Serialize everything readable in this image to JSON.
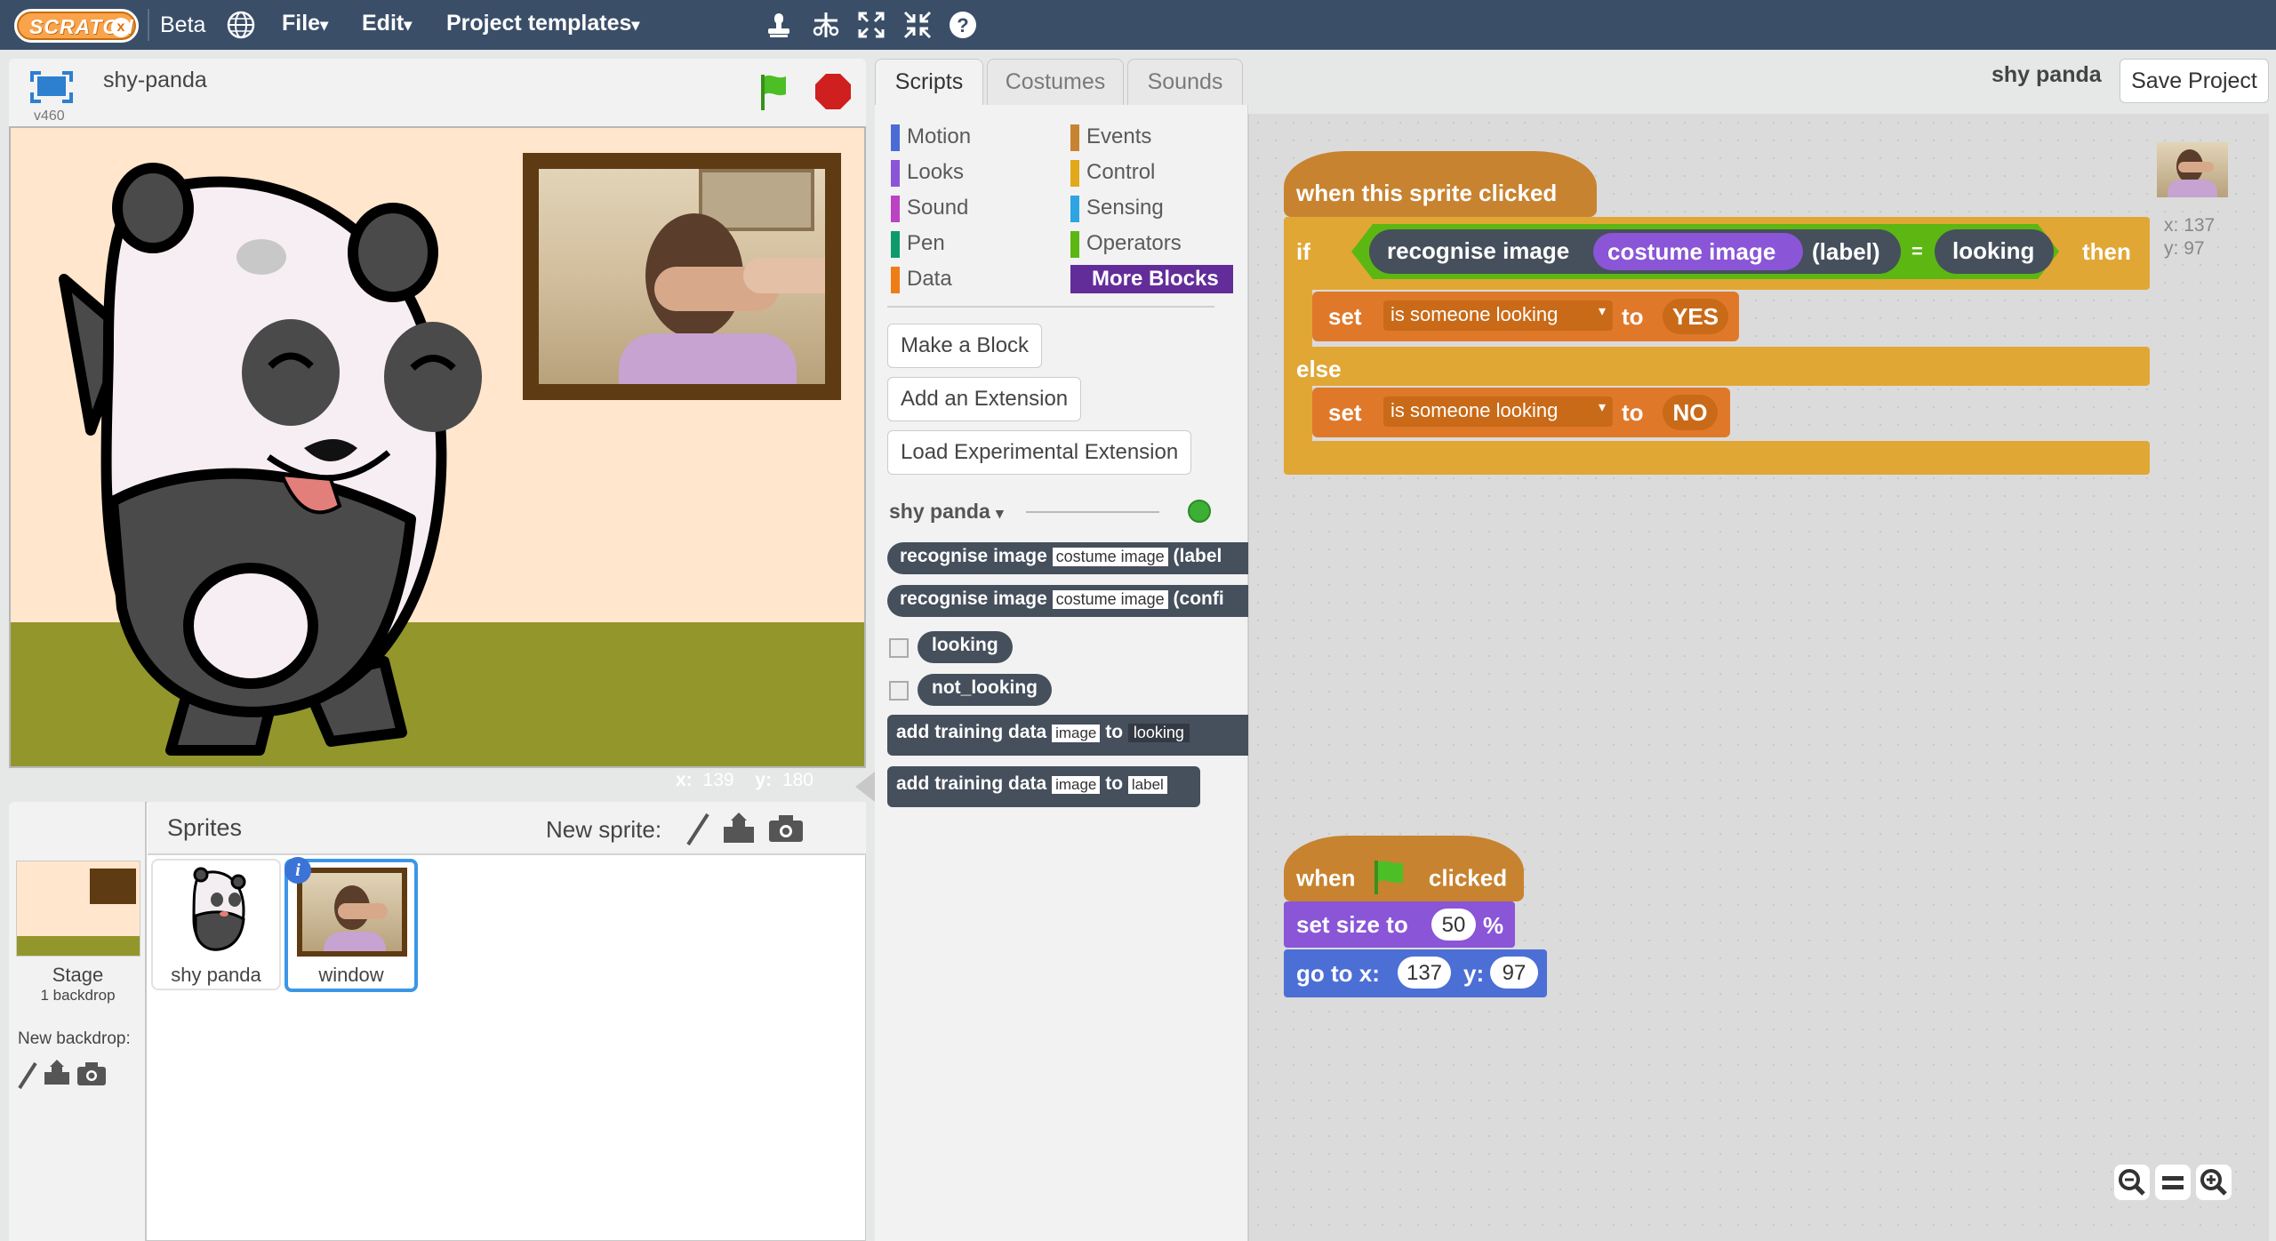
{
  "menubar": {
    "logo_text": "SCRATCH",
    "logo_x": "x",
    "beta": "Beta",
    "file": "File",
    "edit": "Edit",
    "templates": "Project templates",
    "caret": "▾",
    "icons": [
      "duplicate-stamp-icon",
      "cut-scissors-icon",
      "grow-icon",
      "shrink-icon",
      "help-icon"
    ]
  },
  "stage": {
    "project_name": "shy-panda",
    "version": "v460",
    "coords_x_label": "x:",
    "coords_x": "139",
    "coords_y_label": "y:",
    "coords_y": "180"
  },
  "sprites": {
    "header": "Sprites",
    "new_sprite": "New sprite:",
    "stage_label": "Stage",
    "stage_sub": "1 backdrop",
    "new_backdrop": "New backdrop:",
    "items": [
      {
        "name": "shy panda"
      },
      {
        "name": "window"
      }
    ]
  },
  "tabs": [
    {
      "label": "Scripts",
      "active": true
    },
    {
      "label": "Costumes",
      "active": false
    },
    {
      "label": "Sounds",
      "active": false
    }
  ],
  "top_right": {
    "sprite_name": "shy panda",
    "save": "Save Project"
  },
  "palette": {
    "categories_left": [
      "Motion",
      "Looks",
      "Sound",
      "Pen",
      "Data"
    ],
    "categories_right": [
      "Events",
      "Control",
      "Sensing",
      "Operators",
      "More Blocks"
    ],
    "colors_left": [
      "#4a6cd4",
      "#8a55d7",
      "#bb42c3",
      "#0e9a6c",
      "#ee7d16"
    ],
    "colors_right": [
      "#c88330",
      "#e1a91a",
      "#2ca5e2",
      "#5cb712",
      "#632d99"
    ],
    "make_block": "Make a Block",
    "add_extension": "Add an Extension",
    "load_experimental": "Load Experimental Extension",
    "extension_name": "shy panda",
    "status_color": "#3cb034",
    "blocks": {
      "recognise": "recognise",
      "image": "image",
      "costume_image": "costume image",
      "label_arg": "(label",
      "conf_arg": "(confi",
      "looking": "looking",
      "not_looking": "not_looking",
      "add": "add",
      "training": "training",
      "data": "data",
      "image_field": "image",
      "to": "to",
      "looking_field": "looking",
      "label_field": "label"
    }
  },
  "script1": {
    "hat": "when this sprite clicked",
    "if": "if",
    "recognise": "recognise",
    "image": "image",
    "costume_image": "costume image",
    "label": "(label)",
    "eq": "=",
    "looking": "looking",
    "then": "then",
    "set": "set",
    "var": "is someone looking",
    "to": "to",
    "yes": "YES",
    "else": "else",
    "no": "NO"
  },
  "script2": {
    "when": "when",
    "clicked": "clicked",
    "set_size": "set size to",
    "size_val": "50",
    "pct": "%",
    "goto": "go to x:",
    "x_val": "137",
    "y_label": "y:",
    "y_val": "97"
  },
  "sprite_info": {
    "x_label": "x:",
    "x": "137",
    "y_label": "y:",
    "y": "97"
  },
  "zoom": [
    "zoom-out-icon",
    "zoom-reset-icon",
    "zoom-in-icon"
  ]
}
